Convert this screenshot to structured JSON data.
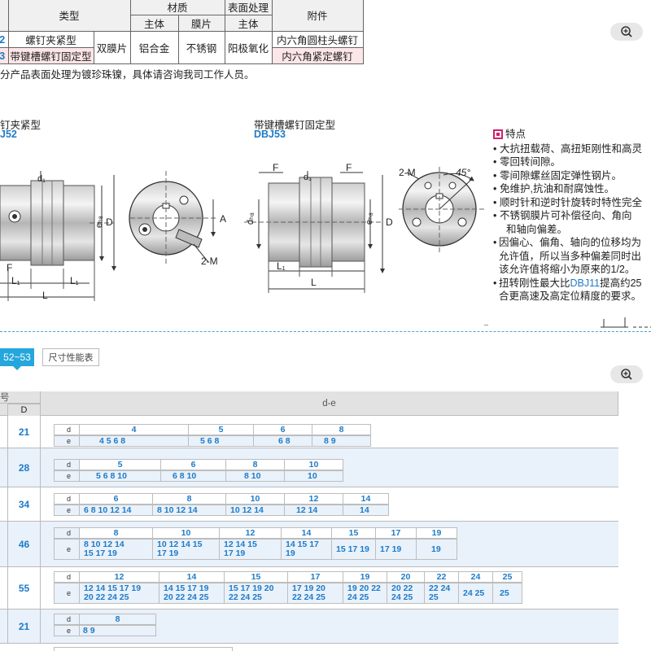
{
  "spec_table": {
    "header_row1": [
      "类型",
      "材质",
      "表面处理",
      "附件"
    ],
    "header_row2": [
      "主体",
      "膜片",
      "主体"
    ],
    "rows": [
      {
        "code": "2",
        "type": "螺钉夹紧型",
        "attachment": "内六角圆柱头螺钉"
      },
      {
        "code": "3",
        "type": "带键槽螺钉固定型",
        "attachment": "内六角紧定螺钉"
      }
    ],
    "shared": {
      "film": "双膜片",
      "body_material": "铝合金",
      "film_material": "不锈钢",
      "surface": "阳极氧化"
    }
  },
  "note": "分产品表面处理为镀珍珠镍，具体请咨询我司工作人员。",
  "drawings": {
    "left": {
      "title": "钉夹紧型",
      "code": "J52"
    },
    "right": {
      "title": "带键槽螺钉固定型",
      "code": "DBJ53"
    },
    "labels": {
      "d1": "d₁",
      "eh8": "eₕ₈",
      "D": "D",
      "A": "A",
      "F": "F",
      "L1": "L₁",
      "L": "L",
      "M": "2-M",
      "angle": "45°",
      "dH8": "dₕ₈"
    }
  },
  "features": {
    "title": "特点",
    "items": [
      "大抗扭载荷、高扭矩刚性和高灵",
      "零回转间隙。",
      "零间隙螺丝固定弹性钢片。",
      "免维护,抗油和耐腐蚀性。",
      "顺时针和逆时针旋转时特性完全",
      "不锈钢膜片可补偿径向、角向"
    ],
    "item6_cont": "和轴向偏差。",
    "para1": [
      "因偏心、偏角、轴向的位移均为",
      "允许值，所以当多种偏差同时出",
      "该允许值将缩小为原来的1/2。"
    ],
    "para2_pre": "扭转刚性最大比",
    "para2_link": "DBJ11",
    "para2_post": "提高约25",
    "para2_line2": "合更高速及高定位精度的要求。"
  },
  "tabs": {
    "active": "52~53",
    "other": "尺寸性能表"
  },
  "size_table": {
    "header_model": "号",
    "header_D": "D",
    "header_de": "d-e",
    "row_labels": {
      "d": "d",
      "e": "e"
    },
    "rows": [
      {
        "D": "21",
        "cols": [
          [
            "4",
            "4 5 6 8"
          ],
          [
            "5",
            "5 6 8"
          ],
          [
            "6",
            "6 8"
          ],
          [
            "8",
            "8 9"
          ]
        ]
      },
      {
        "D": "28",
        "cols": [
          [
            "5",
            "5 6 8 10"
          ],
          [
            "6",
            "6 8 10"
          ],
          [
            "8",
            "8 10"
          ],
          [
            "10",
            "10"
          ]
        ]
      },
      {
        "D": "34",
        "cols": [
          [
            "6",
            "6 8 10 12 14"
          ],
          [
            "8",
            "8 10 12 14"
          ],
          [
            "10",
            "10 12 14"
          ],
          [
            "12",
            "12 14"
          ],
          [
            "14",
            "14"
          ]
        ]
      },
      {
        "D": "46",
        "cols": [
          [
            "8",
            "8 10 12 14",
            "15 17 19"
          ],
          [
            "10",
            "10 12 14 15",
            "17 19"
          ],
          [
            "12",
            "12 14 15",
            "17 19"
          ],
          [
            "14",
            "14 15 17",
            "19"
          ],
          [
            "15",
            "15 17 19"
          ],
          [
            "17",
            "17 19"
          ],
          [
            "19",
            "19"
          ]
        ]
      },
      {
        "D": "55",
        "cols": [
          [
            "12",
            "12 14 15 17 19",
            "20 22 24 25"
          ],
          [
            "14",
            "14 15 17 19",
            "20 22 24 25"
          ],
          [
            "15",
            "15 17 19 20",
            "22 24 25"
          ],
          [
            "17",
            "17 19 20",
            "22 24 25"
          ],
          [
            "19",
            "19 20 22",
            "24 25"
          ],
          [
            "20",
            "20 22",
            "24 25"
          ],
          [
            "22",
            "22 24",
            "25"
          ],
          [
            "24",
            "24 25"
          ],
          [
            "25",
            "25"
          ]
        ]
      },
      {
        "D": "21",
        "cols": [
          [
            "8",
            "8 9"
          ]
        ]
      }
    ]
  }
}
